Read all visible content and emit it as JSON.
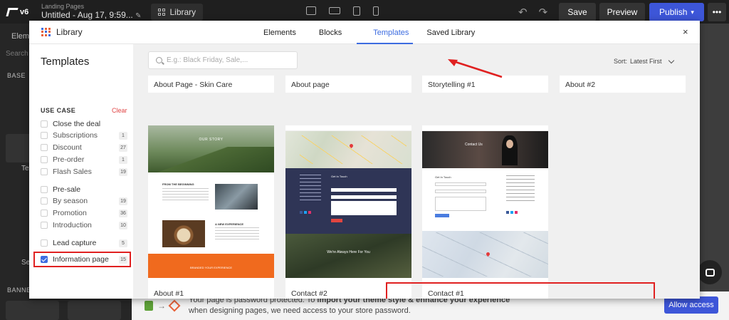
{
  "topbar": {
    "version": "v6",
    "breadcrumb_small": "Landing Pages",
    "page_title": "Untitled - Aug 17, 9:59...",
    "library_label": "Library",
    "save_label": "Save",
    "preview_label": "Preview",
    "publish_label": "Publish",
    "more_label": "•••"
  },
  "leftbar": {
    "tab_label": "Elem",
    "search_label": "Search",
    "base_label": "BASE",
    "text_label": "Tex",
    "section_label": "Se",
    "banner_label": "BANNER"
  },
  "modal": {
    "title": "Library",
    "tabs": [
      {
        "label": "Elements",
        "active": false
      },
      {
        "label": "Blocks",
        "active": false
      },
      {
        "label": "Templates",
        "active": true
      },
      {
        "label": "Saved Library",
        "active": false
      }
    ],
    "close_glyph": "×"
  },
  "filters": {
    "title": "Templates",
    "use_case_label": "USE CASE",
    "clear_label": "Clear",
    "items": [
      {
        "label": "Close the deal",
        "count": "",
        "checked": false
      },
      {
        "label": "Subscriptions",
        "count": "1",
        "checked": false
      },
      {
        "label": "Discount",
        "count": "27",
        "checked": false
      },
      {
        "label": "Pre-order",
        "count": "1",
        "checked": false
      },
      {
        "label": "Flash Sales",
        "count": "19",
        "checked": false
      },
      {
        "label": "Pre-sale",
        "count": "",
        "checked": false
      },
      {
        "label": "By season",
        "count": "19",
        "checked": false
      },
      {
        "label": "Promotion",
        "count": "36",
        "checked": false
      },
      {
        "label": "Introduction",
        "count": "10",
        "checked": false
      },
      {
        "label": "Lead capture",
        "count": "5",
        "checked": false
      },
      {
        "label": "Information page",
        "count": "15",
        "checked": true
      }
    ]
  },
  "content": {
    "search_placeholder": "E.g.: Black Friday, Sale,...",
    "sort_label": "Sort:",
    "sort_value": "Latest First",
    "top_cards": [
      "About Page - Skin Care",
      "About page",
      "Storytelling #1",
      "About #2"
    ],
    "cards": [
      {
        "label": "About #1",
        "hero_text": "OUR STORY",
        "section_text": "FROM THE BEGINNING",
        "section2_text": "A NEW EXPERIENCE",
        "footer_text": "BRANDED YOUR EXPERIENCE"
      },
      {
        "label": "Contact #2",
        "form_title": "Get In Touch",
        "banner_text": "We're Always Here For You"
      },
      {
        "label": "Contact #1",
        "hero_text": "Contact Us",
        "form_title": "Get In Touch"
      }
    ]
  },
  "bottombar": {
    "message_line1_pre": "Your page is password protected. To ",
    "message_line1_bold": "import your theme style & enhance your experience",
    "message_line2": "when designing pages, we need access to your store password.",
    "allow_label": "Allow access"
  },
  "colors": {
    "accent": "#3d6ce0",
    "publish": "#3d56d8",
    "highlight": "#e02020",
    "clear": "#e04444"
  }
}
